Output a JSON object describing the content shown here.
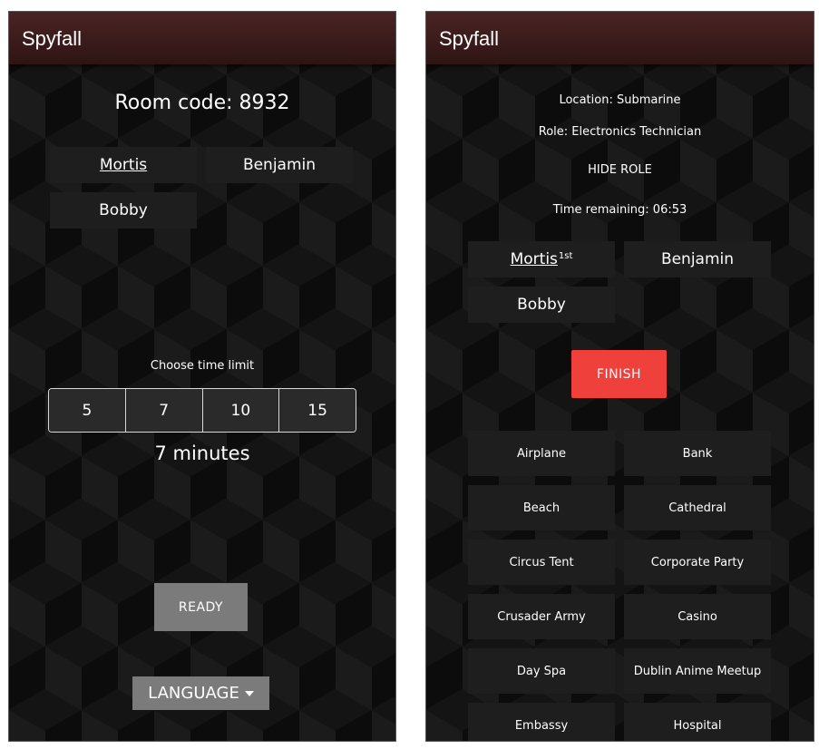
{
  "left": {
    "app_title": "Spyfall",
    "room_code": "Room code: 8932",
    "players": [
      "Mortis",
      "Benjamin",
      "Bobby"
    ],
    "time_limit_label": "Choose time limit",
    "time_options": [
      "5",
      "7",
      "10",
      "15"
    ],
    "selected_time": "7 minutes",
    "ready_label": "READY",
    "language_label": "LANGUAGE"
  },
  "right": {
    "app_title": "Spyfall",
    "location": "Location: Submarine",
    "role": "Role: Electronics Technician",
    "hide_role_label": "HIDE ROLE",
    "time_remaining": "Time remaining: 06:53",
    "players": [
      "Mortis",
      "Benjamin",
      "Bobby"
    ],
    "first_marker": "1st",
    "finish_label": "FINISH",
    "locations": [
      "Airplane",
      "Bank",
      "Beach",
      "Cathedral",
      "Circus Tent",
      "Corporate Party",
      "Crusader Army",
      "Casino",
      "Day Spa",
      "Dublin Anime Meetup",
      "Embassy",
      "Hospital"
    ]
  },
  "colors": {
    "appbar": "#3d1c1c",
    "finish": "#f0403b",
    "button_gray": "#7b7b7b",
    "tile": "#1e1e1e"
  }
}
